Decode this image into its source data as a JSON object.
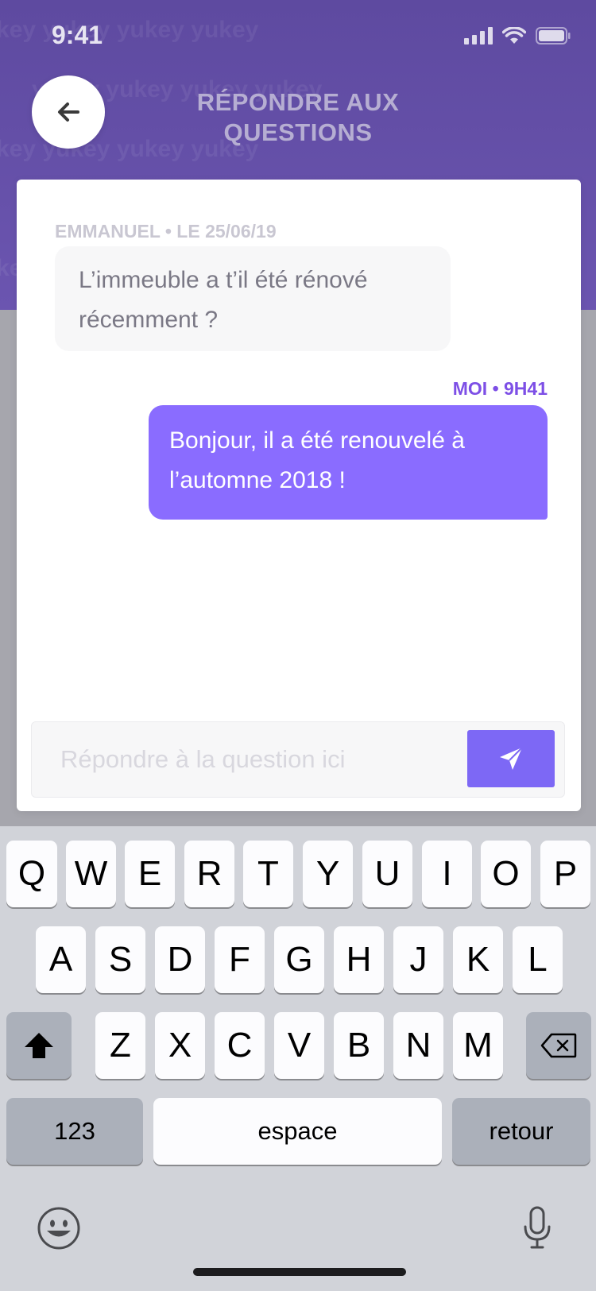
{
  "status_bar": {
    "time": "9:41"
  },
  "header": {
    "title": "RÉPONDRE AUX QUESTIONS",
    "watermark": "yukey",
    "back_icon": "arrow-left-icon"
  },
  "conversation": {
    "incoming": {
      "meta": "EMMANUEL • LE 25/06/19",
      "text": "L’immeuble a t’il été rénové récemment ?"
    },
    "outgoing": {
      "meta": "MOI • 9H41",
      "text": "Bonjour, il a été renouvelé à l’automne 2018 !"
    }
  },
  "reply": {
    "placeholder": "Répondre à la question ici",
    "value": "",
    "send_icon": "paper-plane-icon"
  },
  "keyboard": {
    "row1": [
      "Q",
      "W",
      "E",
      "R",
      "T",
      "Y",
      "U",
      "I",
      "O",
      "P"
    ],
    "row2": [
      "A",
      "S",
      "D",
      "F",
      "G",
      "H",
      "J",
      "K",
      "L"
    ],
    "row3": [
      "Z",
      "X",
      "C",
      "V",
      "B",
      "N",
      "M"
    ],
    "numbers_label": "123",
    "space_label": "espace",
    "return_label": "retour",
    "shift_icon": "shift-icon",
    "delete_icon": "backspace-icon",
    "emoji_icon": "emoji-icon",
    "mic_icon": "microphone-icon"
  },
  "colors": {
    "header": "#5e4aa0",
    "accent": "#8a6cff",
    "send_button": "#7d68f5",
    "meta_me": "#7d4fe6"
  }
}
